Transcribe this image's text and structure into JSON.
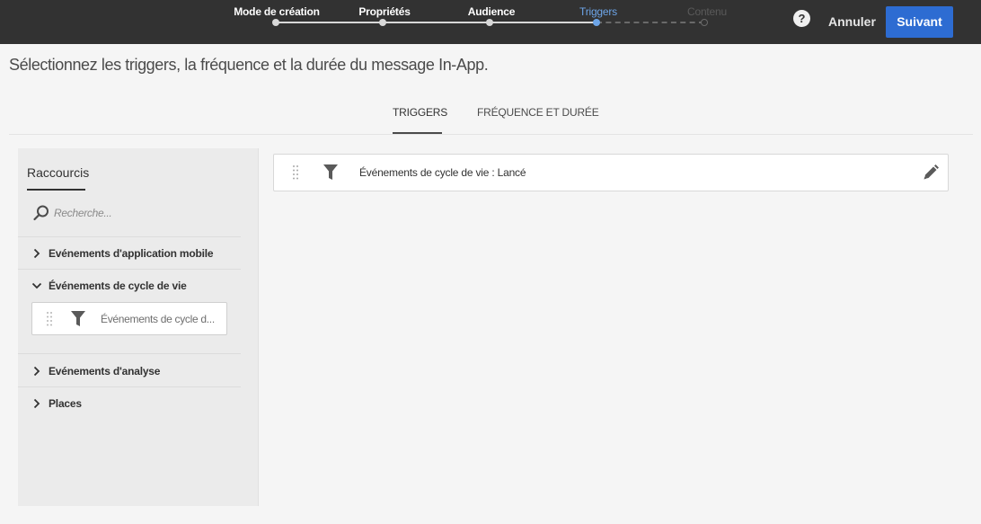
{
  "header": {
    "steps": [
      {
        "label": "Mode de création",
        "state": "done"
      },
      {
        "label": "Propriétés",
        "state": "done"
      },
      {
        "label": "Audience",
        "state": "done"
      },
      {
        "label": "Triggers",
        "state": "active"
      },
      {
        "label": "Contenu",
        "state": "future"
      }
    ],
    "help_label": "?",
    "cancel_label": "Annuler",
    "next_label": "Suivant"
  },
  "page": {
    "title": "Sélectionnez les triggers, la fréquence et la durée du message In-App."
  },
  "tabs": [
    {
      "label": "TRIGGERS",
      "active": true
    },
    {
      "label": "FRÉQUENCE ET DURÉE",
      "active": false
    }
  ],
  "sidebar": {
    "title": "Raccourcis",
    "search_placeholder": "Recherche...",
    "groups": [
      {
        "label": "Evénements d'application mobile",
        "expanded": false
      },
      {
        "label": "Événements de cycle de vie",
        "expanded": true,
        "items": [
          {
            "label": "Événements de cycle d..."
          }
        ]
      },
      {
        "label": "Evénements d'analyse",
        "expanded": false
      },
      {
        "label": "Places",
        "expanded": false
      }
    ]
  },
  "main": {
    "triggers": [
      {
        "label": "Événements de cycle de vie : Lancé"
      }
    ]
  },
  "colors": {
    "topbar_bg": "#323232",
    "accent": "#2d6cd2",
    "active_step": "#6da5e8",
    "page_bg": "#f5f5f5",
    "panel_bg": "#ebebeb"
  },
  "icons": [
    "help-icon",
    "search-icon",
    "chevron-right-icon",
    "chevron-down-icon",
    "drag-handle-icon",
    "filter-icon",
    "pencil-icon"
  ]
}
